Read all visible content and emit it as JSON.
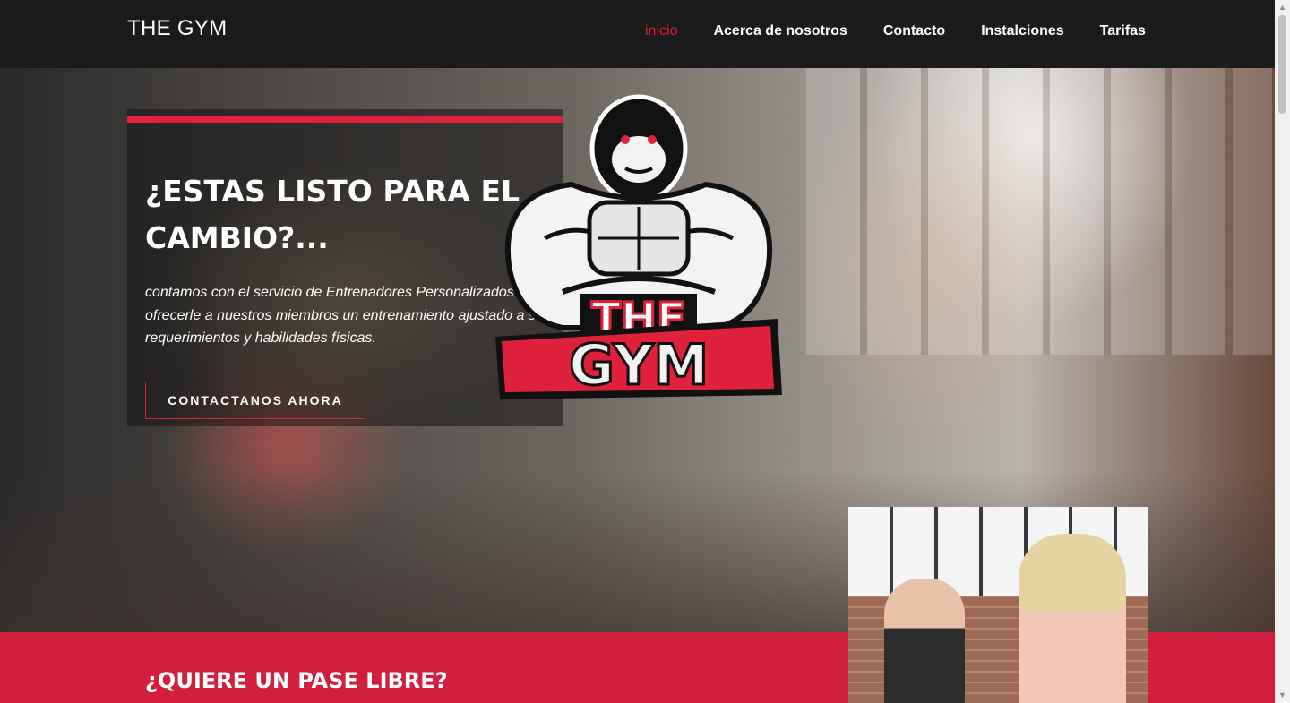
{
  "navbar": {
    "brand": "THE GYM",
    "links": [
      {
        "label": "inicio",
        "active": true
      },
      {
        "label": "Acerca de nosotros",
        "active": false
      },
      {
        "label": "Contacto",
        "active": false
      },
      {
        "label": "Instalciones",
        "active": false
      },
      {
        "label": "Tarifas",
        "active": false
      }
    ]
  },
  "hero": {
    "headline": "¿ESTAS LISTO PARA EL CAMBIO?...",
    "subtext": "contamos con el servicio de Entrenadores Personalizados para ofrecerle a nuestros miembros un entrenamiento ajustado a sus requerimientos y habilidades físicas.",
    "cta_label": "CONTACTANOS AHORA",
    "logo": {
      "line1": "THE",
      "line2": "GYM"
    }
  },
  "pass_section": {
    "title": "¿QUIERE UN PASE LIBRE?"
  },
  "colors": {
    "accent": "#e0213c",
    "navbar_bg": "#1b1b1b",
    "section_bg": "#d11f3c"
  }
}
